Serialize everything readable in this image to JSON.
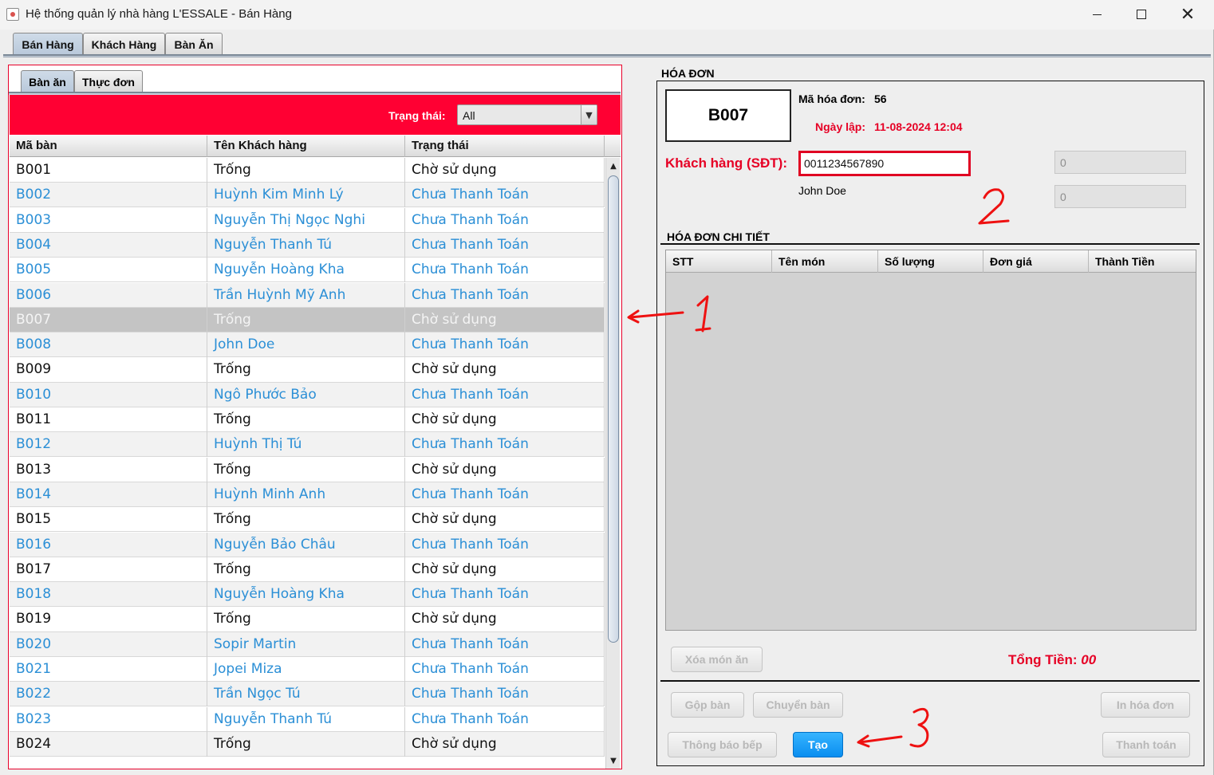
{
  "window": {
    "title": "Hệ thống quản lý nhà hàng L'ESSALE - Bán Hàng"
  },
  "main_tabs": [
    {
      "label": "Bán Hàng"
    },
    {
      "label": "Khách Hàng"
    },
    {
      "label": "Bàn Ăn"
    }
  ],
  "sub_tabs": [
    {
      "label": "Bàn ăn"
    },
    {
      "label": "Thực đơn"
    }
  ],
  "filter": {
    "label": "Trạng thái:",
    "value": "All"
  },
  "table": {
    "headers": [
      "Mã bàn",
      "Tên Khách hàng",
      "Trạng thái"
    ],
    "rows": [
      [
        "B001",
        "Trống",
        "Chờ sử dụng"
      ],
      [
        "B002",
        "Huỳnh Kim Minh Lý",
        "Chưa Thanh Toán"
      ],
      [
        "B003",
        "Nguyễn Thị Ngọc Nghi",
        "Chưa Thanh Toán"
      ],
      [
        "B004",
        "Nguyễn Thanh Tú",
        "Chưa Thanh Toán"
      ],
      [
        "B005",
        "Nguyễn Hoàng Kha",
        "Chưa Thanh Toán"
      ],
      [
        "B006",
        "Trần Huỳnh Mỹ Anh",
        "Chưa Thanh Toán"
      ],
      [
        "B007",
        "Trống",
        "Chờ sử dụng"
      ],
      [
        "B008",
        "John Doe",
        "Chưa Thanh Toán"
      ],
      [
        "B009",
        "Trống",
        "Chờ sử dụng"
      ],
      [
        "B010",
        "Ngô Phước Bảo",
        "Chưa Thanh Toán"
      ],
      [
        "B011",
        "Trống",
        "Chờ sử dụng"
      ],
      [
        "B012",
        "Huỳnh Thị Tú",
        "Chưa Thanh Toán"
      ],
      [
        "B013",
        "Trống",
        "Chờ sử dụng"
      ],
      [
        "B014",
        "Huỳnh Minh Anh",
        "Chưa Thanh Toán"
      ],
      [
        "B015",
        "Trống",
        "Chờ sử dụng"
      ],
      [
        "B016",
        "Nguyễn Bảo Châu",
        "Chưa Thanh Toán"
      ],
      [
        "B017",
        "Trống",
        "Chờ sử dụng"
      ],
      [
        "B018",
        "Nguyễn Hoàng Kha",
        "Chưa Thanh Toán"
      ],
      [
        "B019",
        "Trống",
        "Chờ sử dụng"
      ],
      [
        "B020",
        "Sopir Martin",
        "Chưa Thanh Toán"
      ],
      [
        "B021",
        "Jopei Miza",
        "Chưa Thanh Toán"
      ],
      [
        "B022",
        "Trần Ngọc Tú",
        "Chưa Thanh Toán"
      ],
      [
        "B023",
        "Nguyễn Thanh Tú",
        "Chưa Thanh Toán"
      ],
      [
        "B024",
        "Trống",
        "Chờ sử dụng"
      ]
    ],
    "selected_row": "B007"
  },
  "invoice": {
    "title": "HÓA ĐƠN",
    "table_code": "B007",
    "invoice_id_label": "Mã hóa đơn:",
    "invoice_id": "56",
    "date_label": "Ngày lập:",
    "date": "11-08-2024 12:04",
    "customer_label": "Khách hàng (SĐT):",
    "customer_phone": "0011234567890",
    "customer_name": "John Doe",
    "field_a": "0",
    "field_b": "0"
  },
  "details": {
    "title": "HÓA ĐƠN CHI TIẾT",
    "headers": [
      "STT",
      "Tên món",
      "Số lượng",
      "Đơn giá",
      "Thành Tiền"
    ]
  },
  "buttons": {
    "delete_item": "Xóa món ăn",
    "merge_table": "Gộp bàn",
    "move_table": "Chuyển bàn",
    "print_invoice": "In hóa đơn",
    "kitchen_notify": "Thông báo bếp",
    "create": "Tạo",
    "pay": "Thanh toán"
  },
  "total": {
    "label": "Tổng Tiền:",
    "value": "00"
  },
  "colors": {
    "accent_red": "#ff0033",
    "link_blue": "#2b8fd6",
    "primary_button": "#0a8ef0"
  }
}
